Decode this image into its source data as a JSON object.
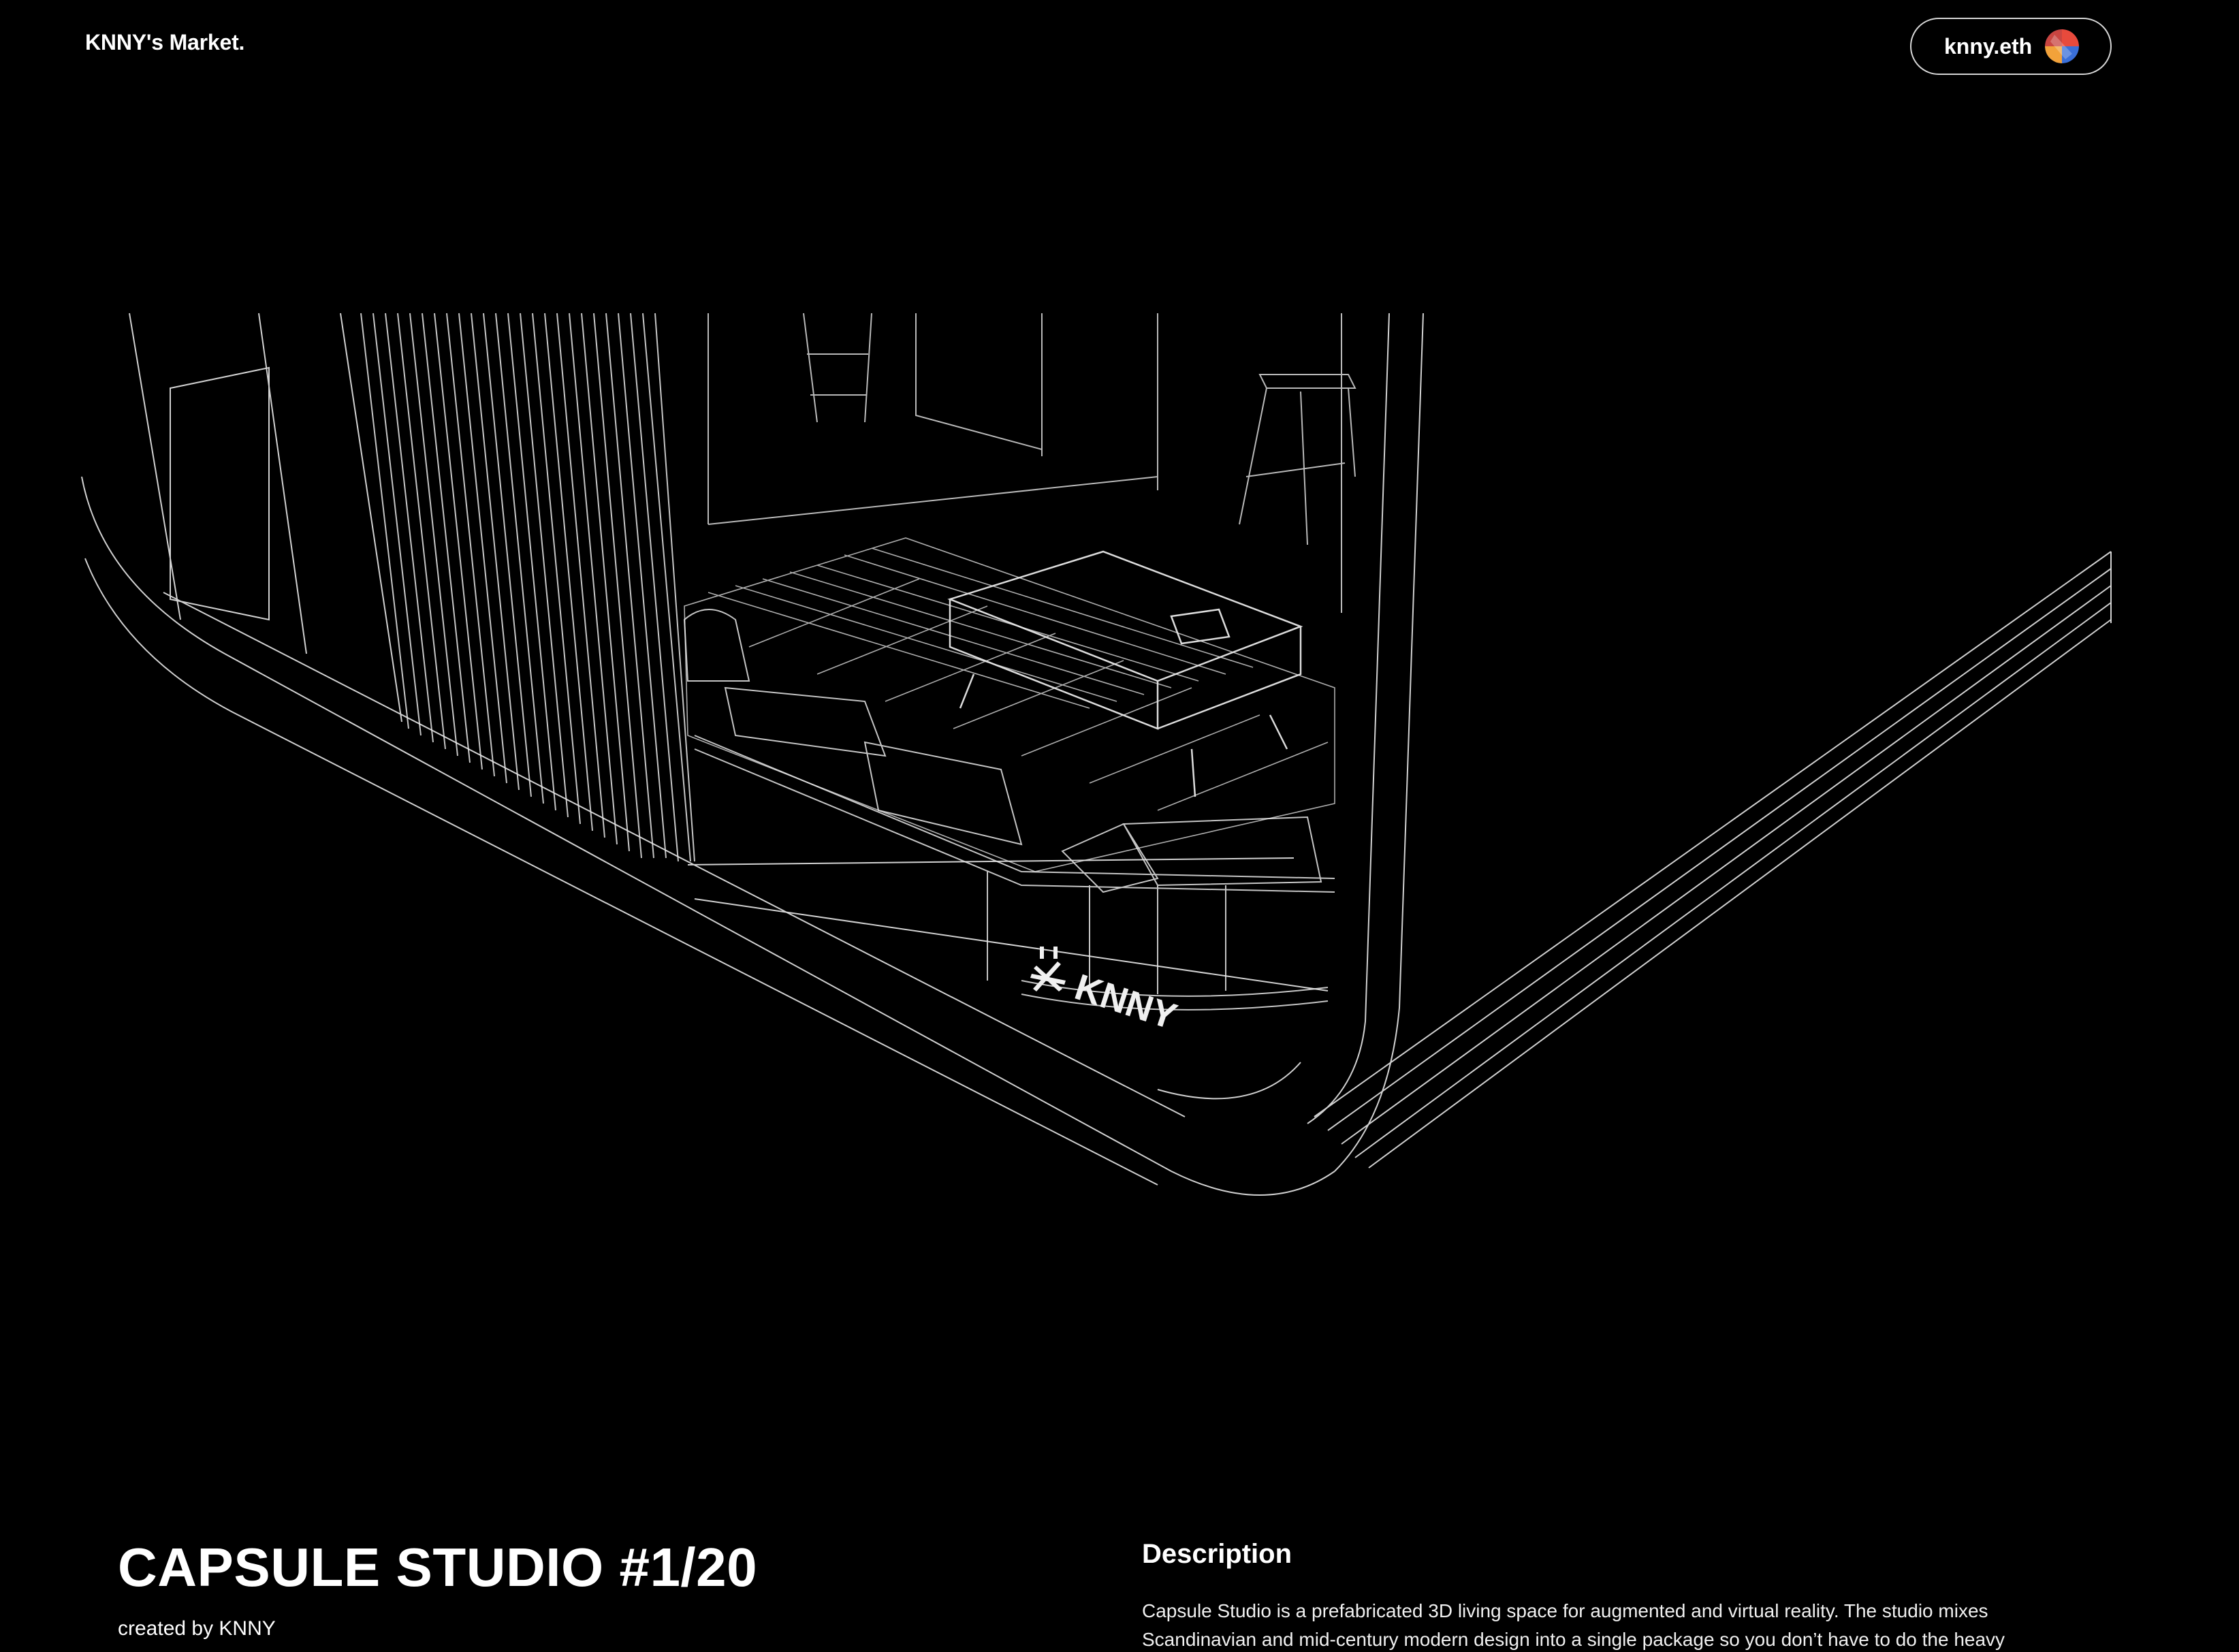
{
  "header": {
    "brand": "KNNY's Market.",
    "wallet_label": "knny.eth"
  },
  "artwork": {
    "logo_text": "KNNY"
  },
  "item": {
    "title": "CAPSULE STUDIO #1/20",
    "creator": "created by KNNY"
  },
  "description": {
    "heading": "Description",
    "text": "Capsule Studio is a prefabricated 3D living space for augmented and virtual reality. The studio mixes Scandinavian and mid-century modern design into a single package so you don’t have to do the heavy"
  },
  "colors": {
    "background": "#000000",
    "text": "#ffffff",
    "wireframe": "#e8e8e8",
    "avatar": [
      "#e84a3c",
      "#3a6fd8",
      "#f2a23a",
      "#1f2a5c"
    ]
  }
}
